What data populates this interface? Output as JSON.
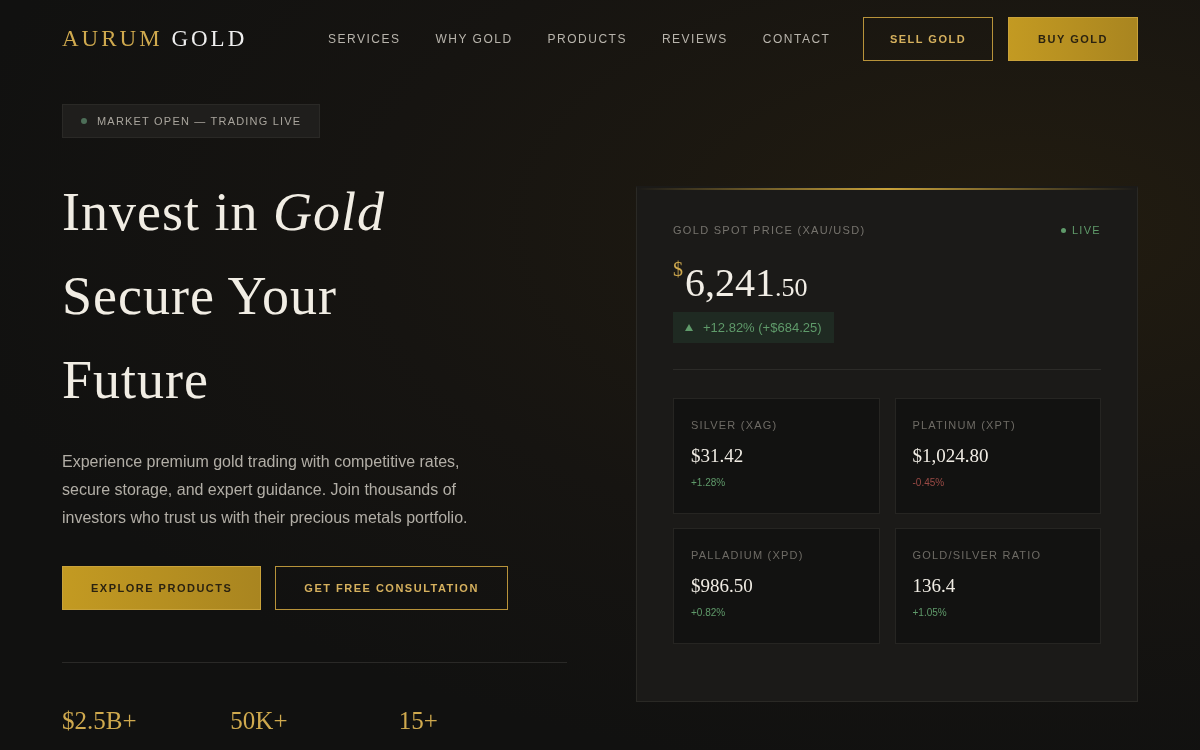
{
  "brand": {
    "first": "AURUM",
    "second": "GOLD"
  },
  "nav": [
    "SERVICES",
    "WHY GOLD",
    "PRODUCTS",
    "REVIEWS",
    "CONTACT"
  ],
  "header_buttons": [
    {
      "label": "SELL GOLD",
      "kind": "outline"
    },
    {
      "label": "BUY GOLD",
      "kind": "solid"
    }
  ],
  "status_badge": {
    "label": "MARKET OPEN — TRADING LIVE"
  },
  "headline": [
    "Invest in *Gold*",
    "Secure Your",
    "Future"
  ],
  "intro": "Experience premium gold trading with competitive rates, secure storage, and expert guidance. Join thousands of investors who trust us with their precious metals portfolio.",
  "cta_buttons": [
    {
      "label": "EXPLORE PRODUCTS",
      "kind": "solid"
    },
    {
      "label": "GET FREE CONSULTATION",
      "kind": "outline"
    }
  ],
  "stats": [
    "$2.5B+",
    "50K+",
    "15+"
  ],
  "price_card": {
    "title": "GOLD SPOT PRICE (XAU/USD)",
    "live": "LIVE",
    "currency": "$",
    "whole": "6,241",
    "fraction": ".50",
    "change": "+12.82% (+$684.25)",
    "metals": [
      {
        "name": "SILVER (XAG)",
        "price": "$31.42",
        "change": "+1.28%",
        "color": "#5f9a6a"
      },
      {
        "name": "PLATINUM (XPT)",
        "price": "$1,024.80",
        "change": "-0.45%",
        "color": "#9a4a45"
      },
      {
        "name": "PALLADIUM (XPD)",
        "price": "$986.50",
        "change": "+0.82%",
        "color": "#5f9a6a"
      },
      {
        "name": "GOLD/SILVER RATIO",
        "price": "136.4",
        "change": "+1.05%",
        "color": "#5f9a6a"
      }
    ]
  }
}
